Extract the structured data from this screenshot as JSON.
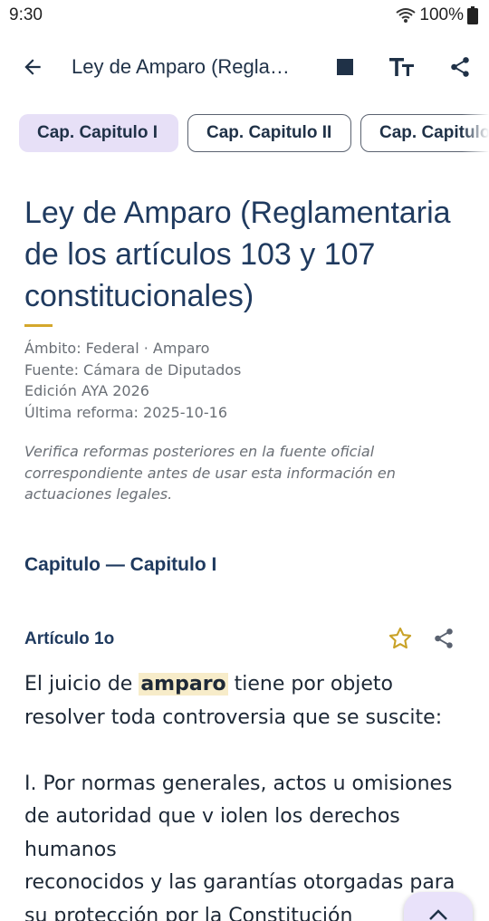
{
  "status": {
    "time": "9:30",
    "battery": "100%",
    "icons": [
      "wifi-icon",
      "battery-icon"
    ]
  },
  "app_bar": {
    "title": "Ley de Amparo (Reglamentaria de los artículos 103 y 107 constitucionales)",
    "actions": [
      "stop-icon",
      "text-size-icon",
      "share-icon"
    ]
  },
  "chips": [
    {
      "label": "Cap. Capitulo I",
      "selected": true
    },
    {
      "label": "Cap. Capitulo II",
      "selected": false
    },
    {
      "label": "Cap. Capitulo III",
      "selected": false
    }
  ],
  "law": {
    "title": "Ley de Amparo (Reglamentaria de los artículos 103 y 107 constitucionales)",
    "meta": [
      "Ámbito: Federal · Amparo",
      "Fuente: Cámara de Diputados",
      "Edición AYA 2026",
      "Última reforma: 2025-10-16"
    ],
    "disclaimer": "Verifica reformas posteriores en la fuente oficial correspondiente antes de usar esta información en actuaciones legales."
  },
  "chapter": {
    "heading": "Capitulo — Capitulo I"
  },
  "article": {
    "label": "Artículo 1o",
    "intro_before": "El juicio de ",
    "intro_highlight": "amparo",
    "intro_after": " tiene por objeto resolver toda controversia que se suscite:",
    "fraction_1": "I. Por normas generales, actos u omisiones de autoridad que v iolen los derechos humanos",
    "fraction_1_cont": "reconocidos y las garantías otorgadas para su protección por la Constitución"
  },
  "colors": {
    "primary_text": "#1f3a5f",
    "accent": "#d4a72c",
    "chip_selected": "#e7e0f7",
    "highlight": "#f7ecc9"
  }
}
